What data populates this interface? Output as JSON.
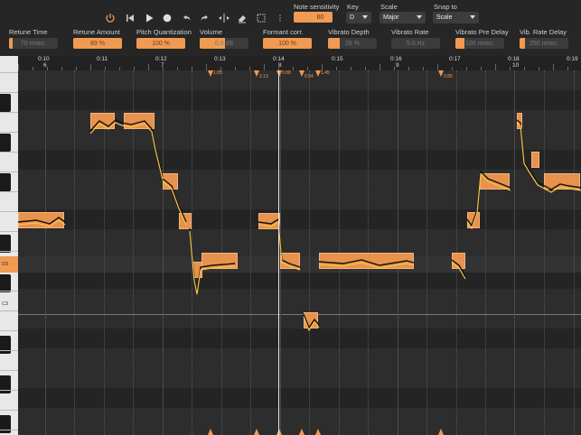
{
  "toolbar": {
    "icons": [
      "power-icon",
      "skip-back-icon",
      "play-icon",
      "record-icon",
      "undo-icon",
      "redo-icon",
      "split-icon",
      "eraser-icon",
      "select-icon",
      "more-icon"
    ],
    "note_sensitivity": {
      "label": "Note sensitivity",
      "value": "60"
    },
    "key": {
      "label": "Key",
      "value": "D"
    },
    "scale": {
      "label": "Scale",
      "value": "Major"
    },
    "snap_to": {
      "label": "Snap to",
      "value": "Scale"
    }
  },
  "params": [
    {
      "label": "Retune Time",
      "value": "70 msec.",
      "fraction": 0.08
    },
    {
      "label": "Retune Amount",
      "value": "89 %",
      "fraction": 1.0
    },
    {
      "label": "Pitch Quantization",
      "value": "100 %",
      "fraction": 1.0
    },
    {
      "label": "Volume",
      "value": "0.0 dB",
      "fraction": 0.52
    },
    {
      "label": "Formant corr.",
      "value": "100 %",
      "fraction": 1.0
    },
    {
      "label": "Vibrato Depth",
      "value": "26 %",
      "fraction": 0.24
    },
    {
      "label": "Vibrato Rate",
      "value": "5.0 Hz",
      "fraction": 0.0
    },
    {
      "label": "Vibrato Pre Delay",
      "value": "100 msec.",
      "fraction": 0.18
    },
    {
      "label": "Vib. Rate Delay",
      "value": "250 msec.",
      "fraction": 0.12
    }
  ],
  "ruler": {
    "times": [
      "0:10",
      "0:11",
      "0:12",
      "0:13",
      "0:14",
      "0:15",
      "0:16",
      "0:17",
      "0:18",
      "0:19"
    ],
    "bars": [
      "6",
      "7",
      "8",
      "9",
      "10"
    ]
  },
  "keyboard": {
    "labels": [
      "D3",
      "C3"
    ]
  },
  "markers": [
    "1.85",
    "2.13",
    "0.88",
    "0.84",
    "1.45",
    "0.85"
  ],
  "colors": {
    "accent": "#f09a52",
    "note": "#e8924d",
    "pitch_curve": "#f5c542",
    "background": "#2a2a2a"
  }
}
